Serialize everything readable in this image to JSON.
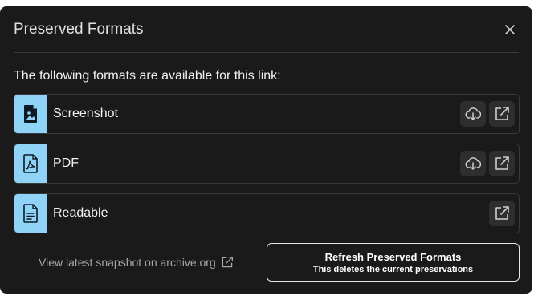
{
  "dialog": {
    "title": "Preserved Formats",
    "intro": "The following formats are available for this link:"
  },
  "formats": [
    {
      "label": "Screenshot",
      "icon": "image-file-icon",
      "actions": [
        "download-icon",
        "open-external-icon"
      ]
    },
    {
      "label": "PDF",
      "icon": "pdf-file-icon",
      "actions": [
        "download-icon",
        "open-external-icon"
      ]
    },
    {
      "label": "Readable",
      "icon": "text-file-icon",
      "actions": [
        "open-external-icon"
      ]
    }
  ],
  "footer": {
    "archive_link": "View latest snapshot on archive.org",
    "refresh_label": "Refresh Preserved Formats",
    "refresh_sublabel": "This deletes the current preservations"
  },
  "colors": {
    "modal_bg": "#1a1a1a",
    "icon_tile": "#8fd4f7",
    "border": "#3a3a3a"
  }
}
